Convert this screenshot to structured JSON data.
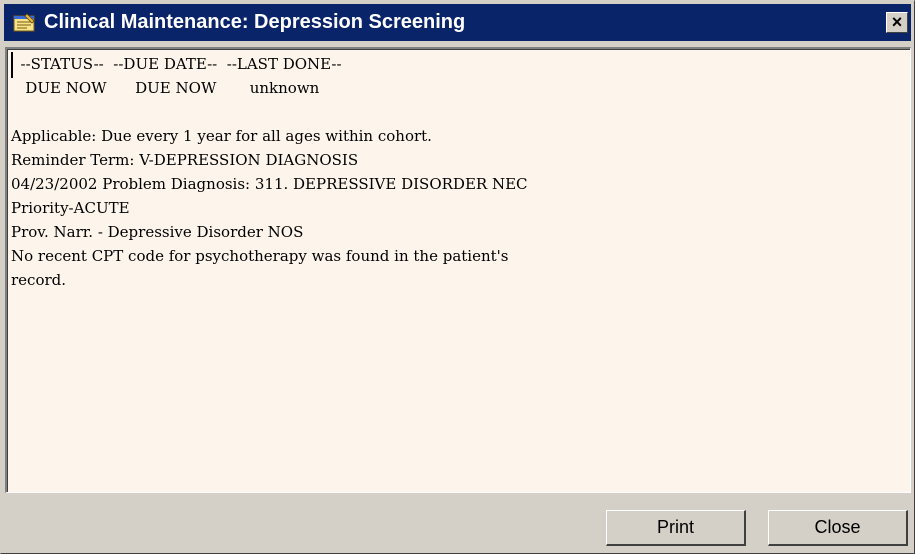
{
  "window": {
    "title": "Clinical Maintenance: Depression Screening",
    "close_glyph": "×"
  },
  "memo": {
    "lines": [
      "  --STATUS--  --DUE DATE--  --LAST DONE--",
      "   DUE NOW      DUE NOW       unknown",
      "",
      "Applicable: Due every 1 year for all ages within cohort.",
      "Reminder Term: V-DEPRESSION DIAGNOSIS",
      "04/23/2002 Problem Diagnosis: 311. DEPRESSIVE DISORDER NEC",
      "Priority-ACUTE",
      "Prov. Narr. - Depressive Disorder NOS",
      "No recent CPT code for psychotherapy was found in the patient's",
      "record."
    ]
  },
  "buttons": {
    "print_label": "Print",
    "close_label": "Close"
  },
  "colors": {
    "titlebar": "#0a246a",
    "memo_background": "#fdf5ec",
    "window_face": "#d4d0c8"
  },
  "icons": {
    "app": "notepad-icon",
    "close": "close-icon"
  }
}
